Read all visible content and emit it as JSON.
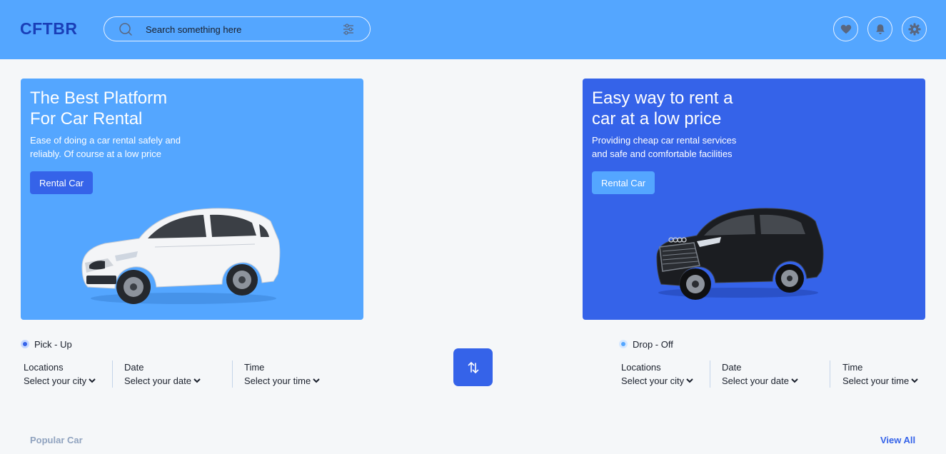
{
  "header": {
    "logo": "CFTBR",
    "search": {
      "placeholder": "Search something here"
    },
    "icons": [
      "heart-icon",
      "bell-icon",
      "settings-icon"
    ]
  },
  "hero_cards": [
    {
      "title_line1": "The Best Platform",
      "title_line2": "For Car Rental",
      "description_line1": "Ease of doing a car rental safely and",
      "description_line2": "reliably. Of course at a low price",
      "button": "Rental Car",
      "background": "#54A6FF",
      "car_color": "white"
    },
    {
      "title_line1": "Easy way to rent a",
      "title_line2": "car at a low price",
      "description_line1": "Providing cheap car rental services",
      "description_line2": "and safe and comfortable facilities",
      "button": "Rental Car",
      "background": "#3563E9",
      "car_color": "black"
    }
  ],
  "pickup": {
    "label": "Pick - Up",
    "fields": [
      {
        "label": "Locations",
        "value": "Select your city"
      },
      {
        "label": "Date",
        "value": "Select your date"
      },
      {
        "label": "Time",
        "value": "Select your time"
      }
    ]
  },
  "dropoff": {
    "label": "Drop - Off",
    "fields": [
      {
        "label": "Locations",
        "value": "Select your city"
      },
      {
        "label": "Date",
        "value": "Select your date"
      },
      {
        "label": "Time",
        "value": "Select your time"
      }
    ]
  },
  "swap_icon": "swap-icon",
  "section": {
    "title": "Popular Car",
    "link": "View All"
  },
  "colors": {
    "primary": "#3563E9",
    "secondary": "#54A6FF",
    "muted": "#90A3BF"
  }
}
